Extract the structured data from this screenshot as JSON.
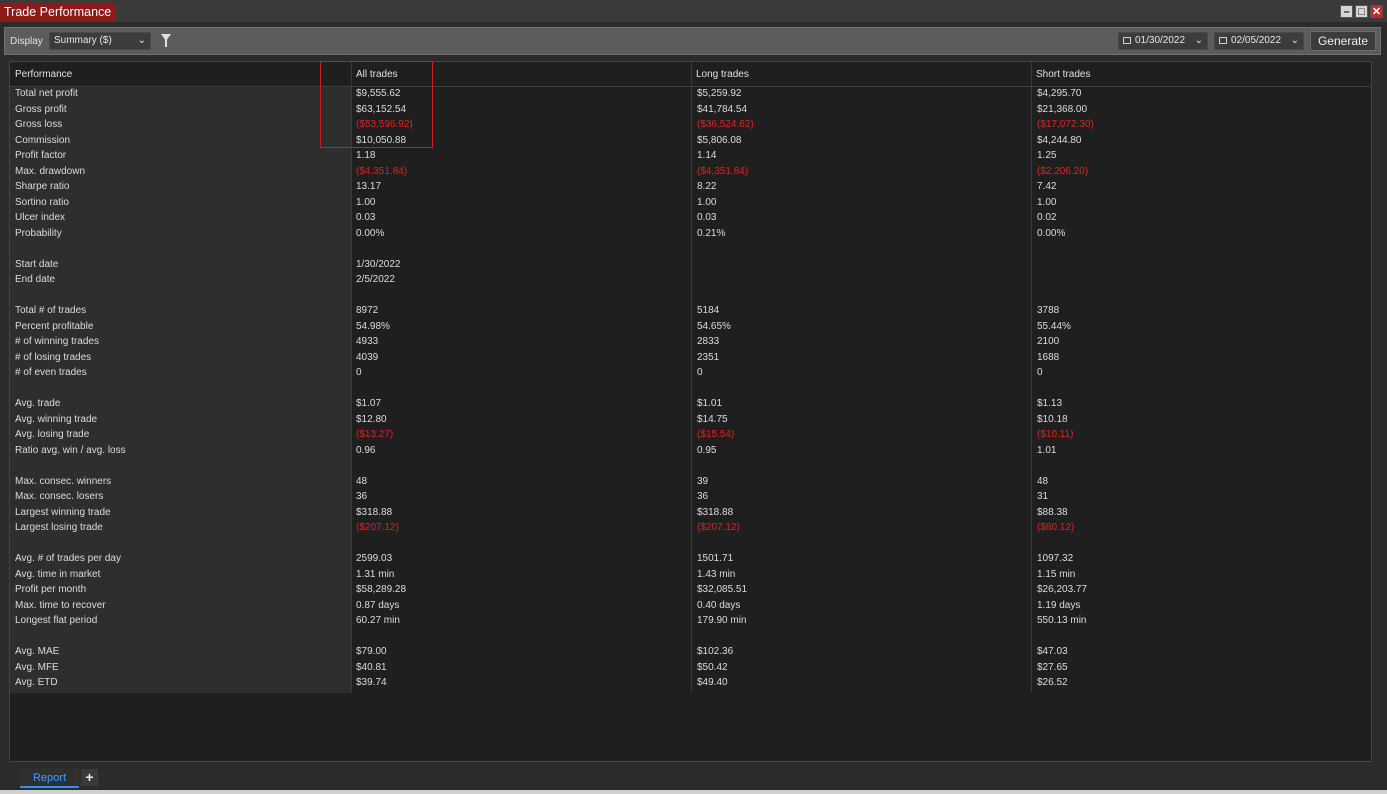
{
  "window": {
    "title": "Trade Performance"
  },
  "toolbar": {
    "display_label": "Display",
    "display_value": "Summary ($)",
    "start_date": "01/30/2022",
    "end_date": "02/05/2022",
    "generate_label": "Generate"
  },
  "table": {
    "headers": [
      "Performance",
      "All trades",
      "Long trades",
      "Short trades"
    ],
    "rows": [
      {
        "label": "Total net profit",
        "all": "$9,555.62",
        "long": "$5,259.92",
        "short": "$4,295.70"
      },
      {
        "label": "Gross profit",
        "all": "$63,152.54",
        "long": "$41,784.54",
        "short": "$21,368.00"
      },
      {
        "label": "Gross loss",
        "all": "($53,596.92)",
        "long": "($36,524.62)",
        "short": "($17,072.30)",
        "negative": true
      },
      {
        "label": "Commission",
        "all": "$10,050.88",
        "long": "$5,806.08",
        "short": "$4,244.80"
      },
      {
        "label": "Profit factor",
        "all": "1.18",
        "long": "1.14",
        "short": "1.25"
      },
      {
        "label": "Max. drawdown",
        "all": "($4,351.84)",
        "long": "($4,351.84)",
        "short": "($2,206.20)",
        "negative": true
      },
      {
        "label": "Sharpe ratio",
        "all": "13.17",
        "long": "8.22",
        "short": "7.42"
      },
      {
        "label": "Sortino ratio",
        "all": "1.00",
        "long": "1.00",
        "short": "1.00"
      },
      {
        "label": "Ulcer index",
        "all": "0.03",
        "long": "0.03",
        "short": "0.02"
      },
      {
        "label": "Probability",
        "all": "0.00%",
        "long": "0.21%",
        "short": "0.00%"
      },
      {
        "label": "",
        "all": "",
        "long": "",
        "short": ""
      },
      {
        "label": "Start date",
        "all": "1/30/2022",
        "long": "",
        "short": ""
      },
      {
        "label": "End date",
        "all": "2/5/2022",
        "long": "",
        "short": ""
      },
      {
        "label": "",
        "all": "",
        "long": "",
        "short": ""
      },
      {
        "label": "Total # of trades",
        "all": "8972",
        "long": "5184",
        "short": "3788"
      },
      {
        "label": "Percent profitable",
        "all": "54.98%",
        "long": "54.65%",
        "short": "55.44%"
      },
      {
        "label": "# of winning trades",
        "all": "4933",
        "long": "2833",
        "short": "2100"
      },
      {
        "label": "# of losing trades",
        "all": "4039",
        "long": "2351",
        "short": "1688"
      },
      {
        "label": "# of even trades",
        "all": "0",
        "long": "0",
        "short": "0"
      },
      {
        "label": "",
        "all": "",
        "long": "",
        "short": ""
      },
      {
        "label": "Avg. trade",
        "all": "$1.07",
        "long": "$1.01",
        "short": "$1.13"
      },
      {
        "label": "Avg. winning trade",
        "all": "$12.80",
        "long": "$14.75",
        "short": "$10.18"
      },
      {
        "label": "Avg. losing trade",
        "all": "($13.27)",
        "long": "($15.54)",
        "short": "($10.11)",
        "negative": true
      },
      {
        "label": "Ratio avg. win / avg. loss",
        "all": "0.96",
        "long": "0.95",
        "short": "1.01"
      },
      {
        "label": "",
        "all": "",
        "long": "",
        "short": ""
      },
      {
        "label": "Max. consec. winners",
        "all": "48",
        "long": "39",
        "short": "48"
      },
      {
        "label": "Max. consec. losers",
        "all": "36",
        "long": "36",
        "short": "31"
      },
      {
        "label": "Largest winning trade",
        "all": "$318.88",
        "long": "$318.88",
        "short": "$88.38"
      },
      {
        "label": "Largest losing trade",
        "all": "($207.12)",
        "long": "($207.12)",
        "short": "($80.12)",
        "negative": true
      },
      {
        "label": "",
        "all": "",
        "long": "",
        "short": ""
      },
      {
        "label": "Avg. # of trades per day",
        "all": "2599.03",
        "long": "1501.71",
        "short": "1097.32"
      },
      {
        "label": "Avg. time in market",
        "all": "1.31 min",
        "long": "1.43 min",
        "short": "1.15 min"
      },
      {
        "label": "Profit per month",
        "all": "$58,289.28",
        "long": "$32,085.51",
        "short": "$26,203.77"
      },
      {
        "label": "Max. time to recover",
        "all": "0.87 days",
        "long": "0.40 days",
        "short": "1.19 days"
      },
      {
        "label": "Longest flat period",
        "all": "60.27 min",
        "long": "179.90 min",
        "short": "550.13 min"
      },
      {
        "label": "",
        "all": "",
        "long": "",
        "short": ""
      },
      {
        "label": "Avg. MAE",
        "all": "$79.00",
        "long": "$102.36",
        "short": "$47.03"
      },
      {
        "label": "Avg. MFE",
        "all": "$40.81",
        "long": "$50.42",
        "short": "$27.65"
      },
      {
        "label": "Avg. ETD",
        "all": "$39.74",
        "long": "$49.40",
        "short": "$26.52"
      }
    ]
  },
  "bottom_tabs": {
    "report_label": "Report",
    "add_label": "+"
  }
}
